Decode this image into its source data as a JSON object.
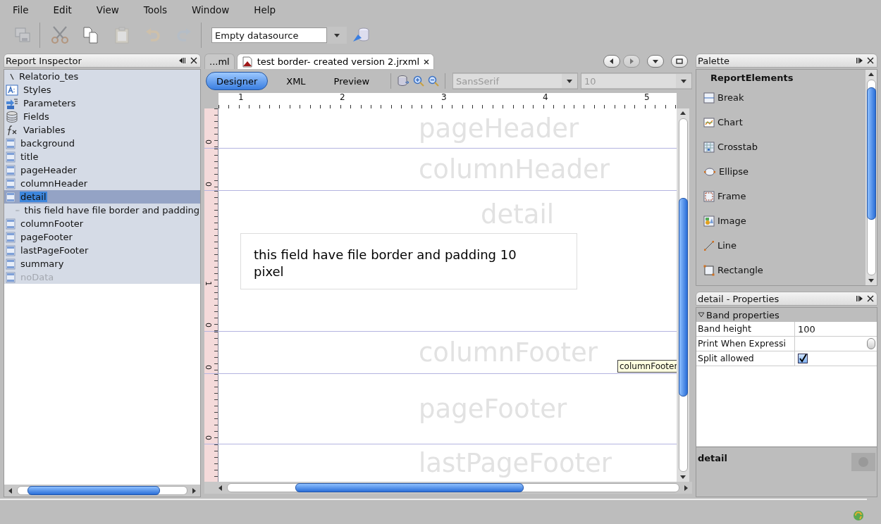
{
  "menu": [
    "File",
    "Edit",
    "View",
    "Tools",
    "Window",
    "Help"
  ],
  "toolbar": [
    {
      "kind": "save",
      "disabled": true
    },
    {
      "kind": "cut",
      "disabled": true
    },
    {
      "kind": "copy",
      "disabled": false
    },
    {
      "kind": "paste",
      "disabled": true
    },
    {
      "kind": "undo",
      "disabled": true
    },
    {
      "kind": "redo",
      "disabled": true
    }
  ],
  "datasource": {
    "value": "Empty datasource"
  },
  "inspector": {
    "title": "Report Inspector",
    "tree": [
      {
        "label": "Relatorio_tes",
        "kind": "report",
        "selected": false,
        "disabled": false,
        "children": [
          {
            "label": "Styles",
            "kind": "styles",
            "selected": false,
            "disabled": false
          },
          {
            "label": "Parameters",
            "kind": "parameters",
            "selected": false,
            "disabled": false
          },
          {
            "label": "Fields",
            "kind": "fields",
            "selected": false,
            "disabled": false
          },
          {
            "label": "Variables",
            "kind": "variables",
            "selected": false,
            "disabled": false
          },
          {
            "label": "background",
            "kind": "band",
            "selected": false,
            "disabled": false
          },
          {
            "label": "title",
            "kind": "band",
            "selected": false,
            "disabled": false
          },
          {
            "label": "pageHeader",
            "kind": "band",
            "selected": false,
            "disabled": false
          },
          {
            "label": "columnHeader",
            "kind": "band",
            "selected": false,
            "disabled": false
          },
          {
            "label": "detail",
            "kind": "band",
            "selected": true,
            "disabled": false,
            "children": [
              {
                "label": "this field have file border and padding",
                "kind": "label",
                "selected": false,
                "disabled": false
              }
            ]
          },
          {
            "label": "columnFooter",
            "kind": "band",
            "selected": false,
            "disabled": false
          },
          {
            "label": "pageFooter",
            "kind": "band",
            "selected": false,
            "disabled": false
          },
          {
            "label": "lastPageFooter",
            "kind": "band",
            "selected": false,
            "disabled": false
          },
          {
            "label": "summary",
            "kind": "band",
            "selected": false,
            "disabled": false
          },
          {
            "label": "noData",
            "kind": "band",
            "selected": false,
            "disabled": true
          }
        ]
      }
    ]
  },
  "editor_tabs": [
    {
      "label": "...ml",
      "selected": false,
      "closable": false
    },
    {
      "label": "test border- created version 2.jrxml",
      "selected": true,
      "closable": true
    }
  ],
  "views": [
    {
      "label": "Designer",
      "selected": true
    },
    {
      "label": "XML",
      "selected": false
    },
    {
      "label": "Preview",
      "selected": false
    }
  ],
  "font": {
    "family": "SansSerif",
    "size": "10",
    "disabled": true
  },
  "ruler": [
    "1",
    "2",
    "3",
    "4",
    "5"
  ],
  "bands": [
    {
      "name": "pageHeader",
      "ruler_marks": [
        "0"
      ]
    },
    {
      "name": "columnHeader",
      "ruler_marks": [
        "0"
      ]
    },
    {
      "name": "detail",
      "ruler_marks": [
        "1",
        "0"
      ],
      "elements": [
        {
          "text": "this field have file border and padding 10 pixel"
        }
      ]
    },
    {
      "name": "columnFooter",
      "ruler_marks": [
        "0"
      ]
    },
    {
      "name": "pageFooter",
      "ruler_marks": [
        "0"
      ]
    },
    {
      "name": "lastPageFooter"
    }
  ],
  "tooltip": "columnFooter",
  "palette": {
    "title": "Palette",
    "group": "ReportElements",
    "items": [
      {
        "label": "Break",
        "kind": "break"
      },
      {
        "label": "Chart",
        "kind": "chart"
      },
      {
        "label": "Crosstab",
        "kind": "crosstab"
      },
      {
        "label": "Ellipse",
        "kind": "ellipse"
      },
      {
        "label": "Frame",
        "kind": "frame"
      },
      {
        "label": "Image",
        "kind": "image"
      },
      {
        "label": "Line",
        "kind": "line"
      },
      {
        "label": "Rectangle",
        "kind": "rectangle"
      }
    ]
  },
  "properties": {
    "title": "detail - Properties",
    "section": {
      "label": "Band properties",
      "expanded": true
    },
    "rows": [
      {
        "name": "Band height",
        "kind": "text",
        "value": "100"
      },
      {
        "name": "Print When Expressi",
        "kind": "expression"
      },
      {
        "name": "Split allowed",
        "kind": "checkbox",
        "checked": true
      }
    ],
    "description": "detail"
  }
}
